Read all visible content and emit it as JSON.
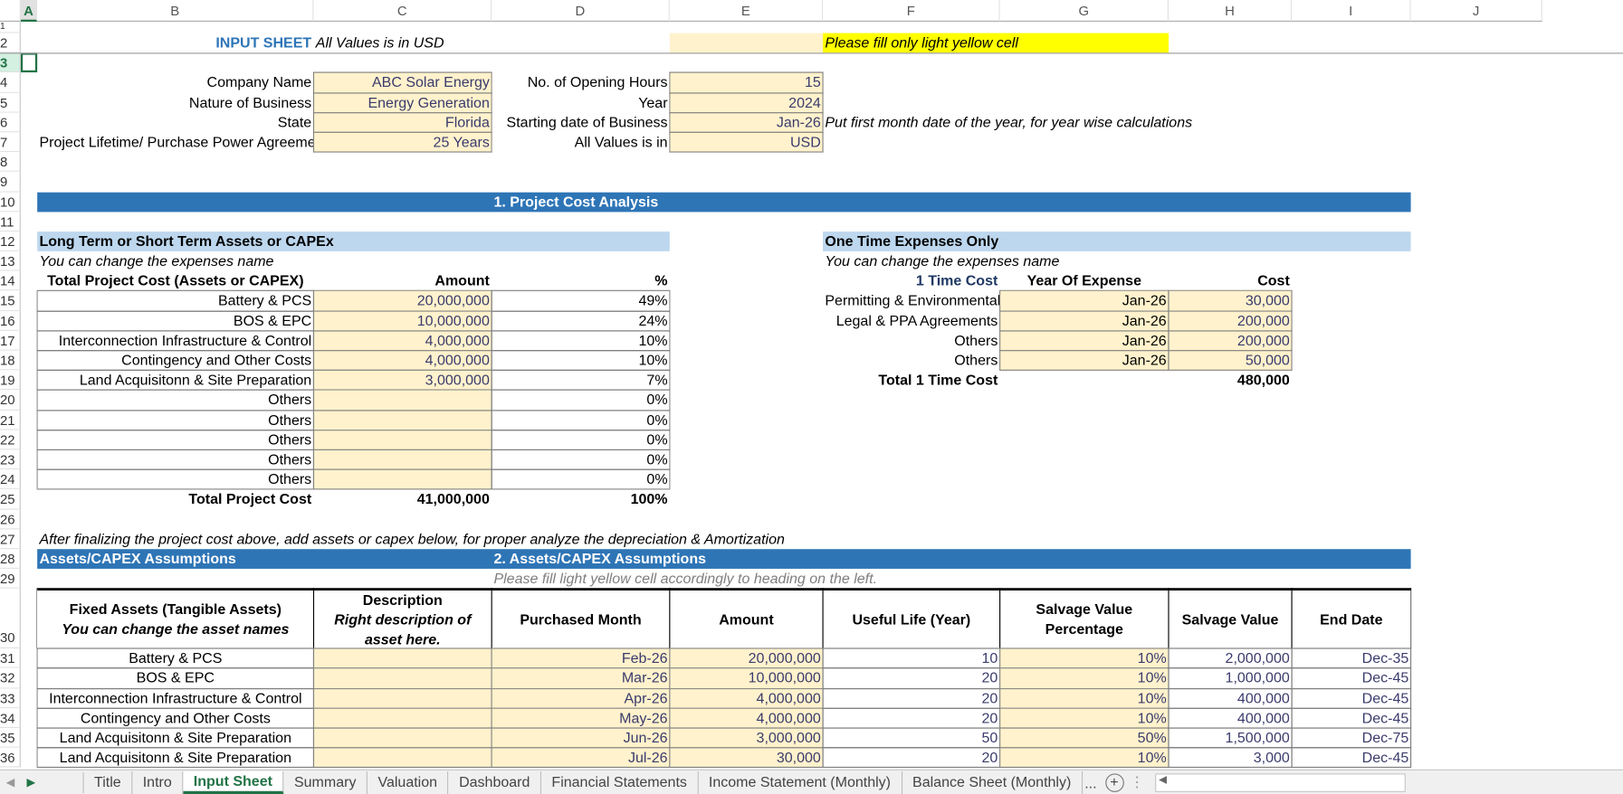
{
  "columns": [
    "A",
    "B",
    "C",
    "D",
    "E",
    "F",
    "G",
    "H",
    "I",
    "J"
  ],
  "rows": [
    "1",
    "2",
    "3",
    "4",
    "5",
    "6",
    "7",
    "8",
    "9",
    "10",
    "11",
    "12",
    "13",
    "14",
    "15",
    "16",
    "17",
    "18",
    "19",
    "20",
    "21",
    "22",
    "23",
    "24",
    "25",
    "26",
    "27",
    "28",
    "29",
    "30",
    "31",
    "32",
    "33",
    "34",
    "35",
    "36"
  ],
  "selected_cell": "A3",
  "colors": {
    "input_fill": "#FFF2CC",
    "note_fill": "#FFFF00",
    "section_band": "#2E75B6",
    "sub_band": "#BDD7EE",
    "accent_green": "#217346"
  },
  "sheet": {
    "title": "INPUT SHEET",
    "currency_note": "All Values is in USD",
    "fill_note": "Please fill only light yellow cell"
  },
  "company": {
    "left": [
      {
        "label": "Company Name",
        "value": "ABC Solar Energy"
      },
      {
        "label": "Nature of Business",
        "value": "Energy Generation"
      },
      {
        "label": "State",
        "value": "Florida"
      },
      {
        "label": "Project Lifetime/ Purchase Power Agreement",
        "value": "25 Years"
      }
    ],
    "right": [
      {
        "label": "No. of Opening Hours",
        "value": "15"
      },
      {
        "label": "Year",
        "value": "2024"
      },
      {
        "label": "Starting date of Business",
        "value": "Jan-26"
      },
      {
        "label": "All Values is in",
        "value": "USD"
      }
    ],
    "start_note": "Put first month date of the year, for year wise calculations"
  },
  "cost_analysis": {
    "section_title": "1. Project Cost Analysis",
    "capex": {
      "title": "Long Term or Short Term Assets or CAPEx",
      "note": "You can change the expenses name",
      "headers": [
        "Total Project Cost (Assets or CAPEX)",
        "Amount",
        "%"
      ],
      "rows": [
        [
          "Battery & PCS",
          "20,000,000",
          "49%"
        ],
        [
          "BOS & EPC",
          "10,000,000",
          "24%"
        ],
        [
          "Interconnection Infrastructure & Control",
          "4,000,000",
          "10%"
        ],
        [
          "Contingency and Other Costs",
          "4,000,000",
          "10%"
        ],
        [
          "Land Acquisitonn & Site Preparation",
          "3,000,000",
          "7%"
        ],
        [
          "Others",
          "",
          "0%"
        ],
        [
          "Others",
          "",
          "0%"
        ],
        [
          "Others",
          "",
          "0%"
        ],
        [
          "Others",
          "",
          "0%"
        ],
        [
          "Others",
          "",
          "0%"
        ]
      ],
      "total": [
        "Total Project Cost",
        "41,000,000",
        "100%"
      ]
    },
    "one_time": {
      "title": "One Time Expenses Only",
      "note": "You can change the expenses name",
      "headers": [
        "1 Time Cost",
        "Year Of Expense",
        "Cost"
      ],
      "rows": [
        [
          "Permitting & Environmental Studies",
          "Jan-26",
          "30,000"
        ],
        [
          "Legal & PPA Agreements",
          "Jan-26",
          "200,000"
        ],
        [
          "Others",
          "Jan-26",
          "200,000"
        ],
        [
          "Others",
          "Jan-26",
          "50,000"
        ]
      ],
      "total": [
        "Total 1 Time Cost",
        "480,000"
      ]
    }
  },
  "assets": {
    "intro_note": "After finalizing the project cost above, add assets or capex below, for proper analyze the depreciation & Amortization",
    "band_left": "Assets/CAPEX Assumptions",
    "section_title": "2. Assets/CAPEX Assumptions",
    "fill_note": "Please fill light yellow cell accordingly to heading on the left.",
    "headers": [
      [
        "Fixed Assets (Tangible Assets)",
        "You can change the asset names"
      ],
      [
        "Description",
        "Right description of asset here."
      ],
      [
        "Purchased  Month"
      ],
      [
        "Amount"
      ],
      [
        "Useful Life (Year)"
      ],
      [
        "Salvage Value Percentage"
      ],
      [
        "Salvage Value"
      ],
      [
        "End Date"
      ]
    ],
    "rows": [
      [
        "Battery & PCS",
        "",
        "Feb-26",
        "20,000,000",
        "10",
        "10%",
        "2,000,000",
        "Dec-35"
      ],
      [
        "BOS & EPC",
        "",
        "Mar-26",
        "10,000,000",
        "20",
        "10%",
        "1,000,000",
        "Dec-45"
      ],
      [
        "Interconnection Infrastructure & Control",
        "",
        "Apr-26",
        "4,000,000",
        "20",
        "10%",
        "400,000",
        "Dec-45"
      ],
      [
        "Contingency and Other Costs",
        "",
        "May-26",
        "4,000,000",
        "20",
        "10%",
        "400,000",
        "Dec-45"
      ],
      [
        "Land Acquisitonn & Site Preparation",
        "",
        "Jun-26",
        "3,000,000",
        "50",
        "50%",
        "1,500,000",
        "Dec-75"
      ],
      [
        "Land Acquisitonn & Site Preparation",
        "",
        "Jul-26",
        "30,000",
        "20",
        "10%",
        "3,000",
        "Dec-45"
      ]
    ]
  },
  "tabs": {
    "items": [
      "Title",
      "Intro",
      "Input Sheet",
      "Summary",
      "Valuation",
      "Dashboard",
      "Financial Statements",
      "Income Statement (Monthly)",
      "Balance Sheet (Monthly)"
    ],
    "active": "Input Sheet",
    "more": "...",
    "add_icon": "plus-circle-icon"
  }
}
